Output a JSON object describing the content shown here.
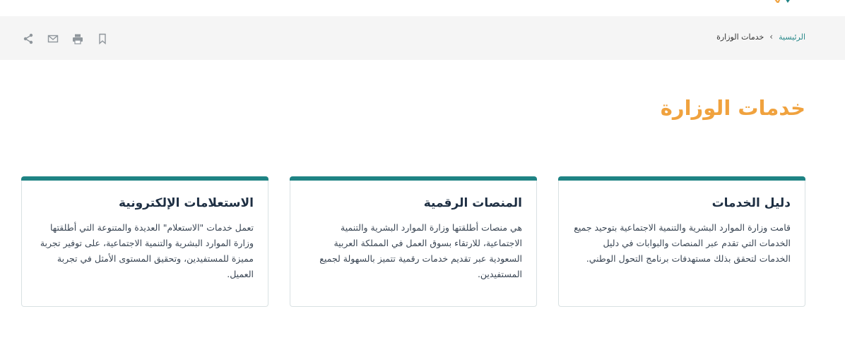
{
  "breadcrumb": {
    "home": "الرئيسية",
    "separator": "›",
    "current": "خدمات الوزارة"
  },
  "toolbar": {
    "icons": [
      "bookmark-icon",
      "print-icon",
      "email-icon",
      "share-icon"
    ]
  },
  "page": {
    "title": "خدمات الوزارة"
  },
  "cards": [
    {
      "title": "دليل الخدمات",
      "description": "قامت وزارة الموارد البشرية والتنمية الاجتماعية بتوحيد جميع الخدمات التي تقدم عبر المنصات والبوابات في دليل الخدمات لتحقق بذلك مستهدفات برنامج التحول الوطني."
    },
    {
      "title": "المنصات الرقمية",
      "description": "هي منصات أطلقتها وزارة الموارد البشرية والتنمية الاجتماعية، للارتقاء بسوق العمل في المملكة العربية السعودية عبر تقديم خدمات رقمية تتميز بالسهولة لجميع المستفيدين."
    },
    {
      "title": "الاستعلامات الإلكترونية",
      "description": "تعمل خدمات \"الاستعلام\" العديدة والمتنوعة التي أطلقتها وزارة الموارد البشرية والتنمية الاجتماعية، على توفير تجربة مميزة للمستفيدين، وتحقيق المستوى الأمثل في تجربة العميل."
    }
  ],
  "colors": {
    "accent": "#f0a23e",
    "teal": "#1f8384",
    "link": "#2a8a8b"
  }
}
